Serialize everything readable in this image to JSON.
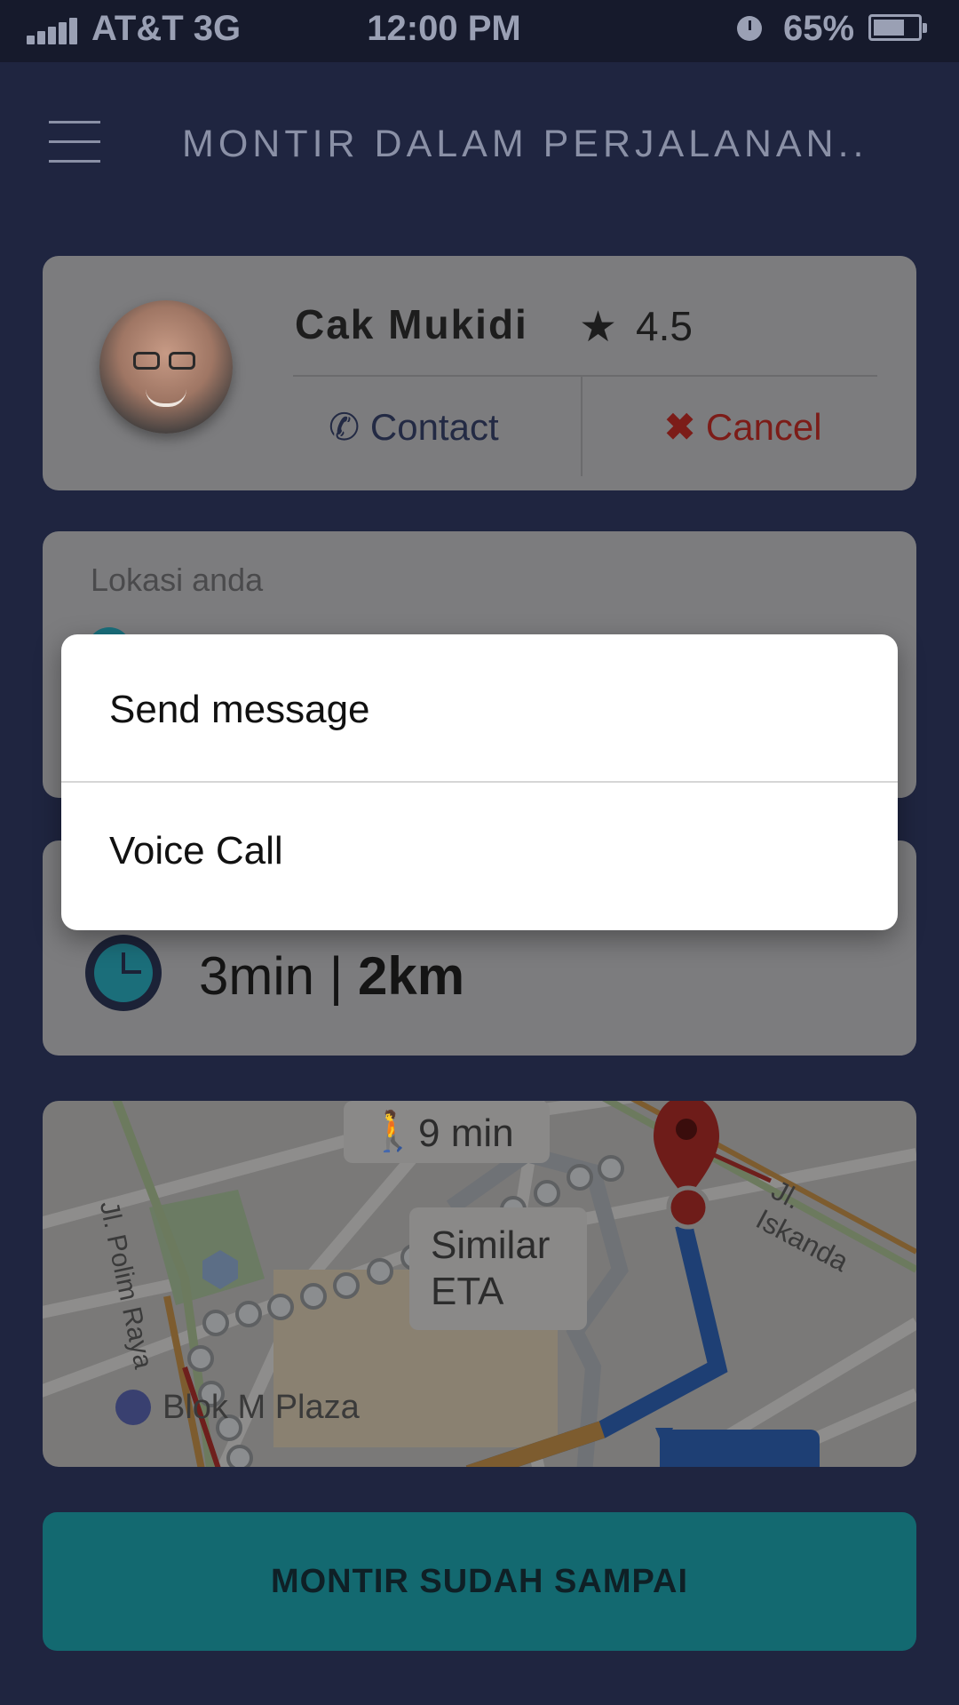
{
  "status_bar": {
    "carrier": "AT&T  3G",
    "time": "12:00 PM",
    "battery": "65%",
    "battery_level": 0.65
  },
  "header": {
    "title": "MONTIR DALAM PERJALANAN.."
  },
  "mechanic": {
    "name": "Cak Mukidi",
    "rating": "4.5",
    "contact_label": "Contact",
    "cancel_label": "Cancel"
  },
  "location": {
    "label": "Lokasi anda"
  },
  "eta": {
    "time": "3min",
    "separator": "|",
    "distance": "2km"
  },
  "map": {
    "walk_time": "9 min",
    "similar_eta": [
      "Similar",
      "ETA"
    ],
    "place": "Blok M Plaza",
    "road_left": "Jl. Polim Raya",
    "road_right": "Jl. Iskanda"
  },
  "action": {
    "arrived_label": "MONTIR SUDAH SAMPAI"
  },
  "contact_sheet": {
    "options": [
      {
        "label": "Send message"
      },
      {
        "label": "Voice Call"
      }
    ]
  },
  "colors": {
    "background": "#1f2540",
    "accent": "#136970",
    "cancel": "#7c1c18",
    "sheet": "#ffffff"
  }
}
